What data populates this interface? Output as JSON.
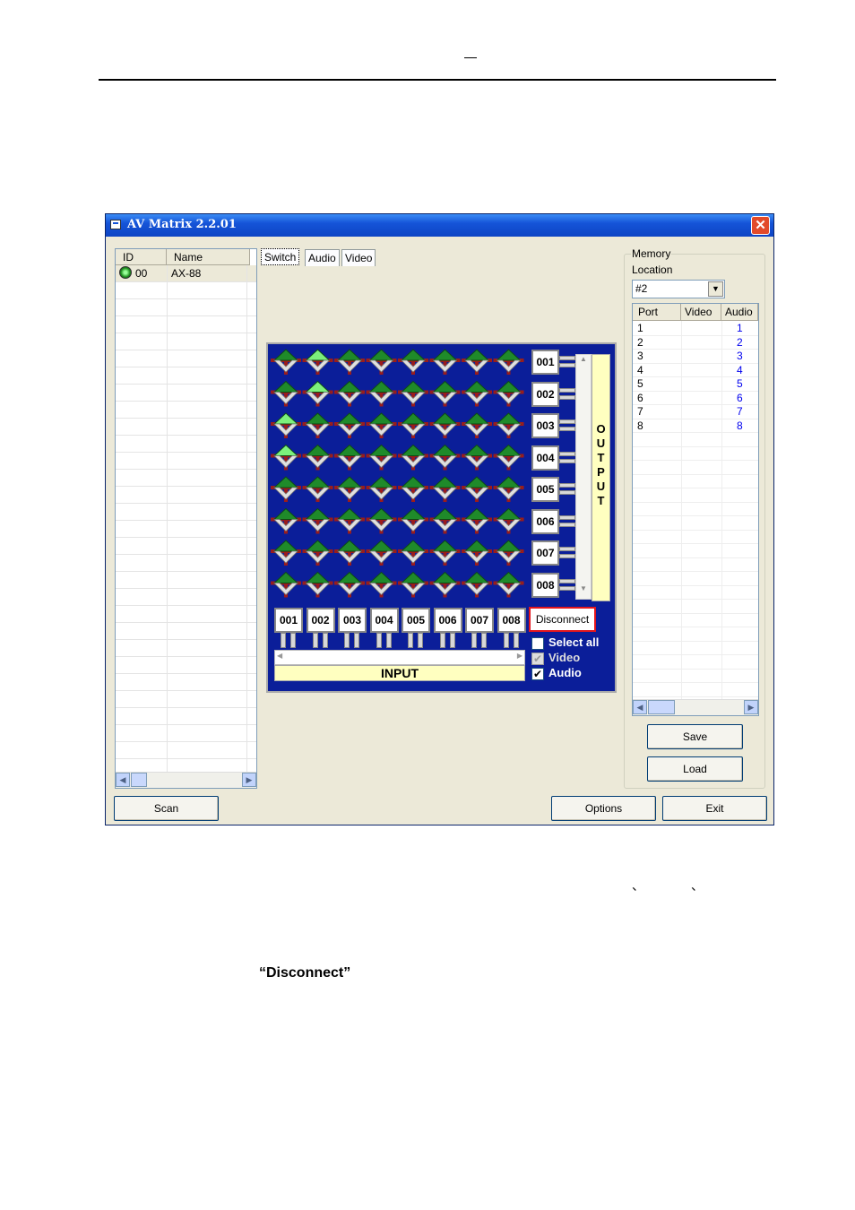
{
  "window": {
    "title": "AV Matrix 2.2.01",
    "close": "✕"
  },
  "device_list": {
    "columns": [
      "ID",
      "Name"
    ],
    "rows": [
      {
        "id": "00",
        "name": "AX-88"
      }
    ]
  },
  "tabs": [
    "Switch",
    "Audio",
    "Video"
  ],
  "matrix": {
    "outputs": [
      "001",
      "002",
      "003",
      "004",
      "005",
      "006",
      "007",
      "008"
    ],
    "inputs": [
      "001",
      "002",
      "003",
      "004",
      "005",
      "006",
      "007",
      "008"
    ],
    "output_label": "OUTPUT",
    "input_label": "INPUT",
    "disconnect": "Disconnect",
    "select_all": "Select all",
    "video": "Video",
    "audio": "Audio",
    "active_routes": [
      {
        "output": "001",
        "input": "002"
      },
      {
        "output": "002",
        "input": "002"
      },
      {
        "output": "003",
        "input": "001"
      },
      {
        "output": "004",
        "input": "001"
      }
    ]
  },
  "memory": {
    "group_label": "Memory",
    "location_label": "Location",
    "location_value": "#2",
    "columns": [
      "Port",
      "Video",
      "Audio"
    ],
    "rows": [
      {
        "port": "1",
        "video": "",
        "audio": "1"
      },
      {
        "port": "2",
        "video": "",
        "audio": "2"
      },
      {
        "port": "3",
        "video": "",
        "audio": "3"
      },
      {
        "port": "4",
        "video": "",
        "audio": "4"
      },
      {
        "port": "5",
        "video": "",
        "audio": "5"
      },
      {
        "port": "6",
        "video": "",
        "audio": "6"
      },
      {
        "port": "7",
        "video": "",
        "audio": "7"
      },
      {
        "port": "8",
        "video": "",
        "audio": "8"
      }
    ],
    "save": "Save",
    "load": "Load"
  },
  "bottom_buttons": {
    "scan": "Scan",
    "options": "Options",
    "exit": "Exit"
  },
  "doc": {
    "header_dash": "—",
    "quoted": "“Disconnect”",
    "tick1": "、",
    "tick2": "、"
  }
}
